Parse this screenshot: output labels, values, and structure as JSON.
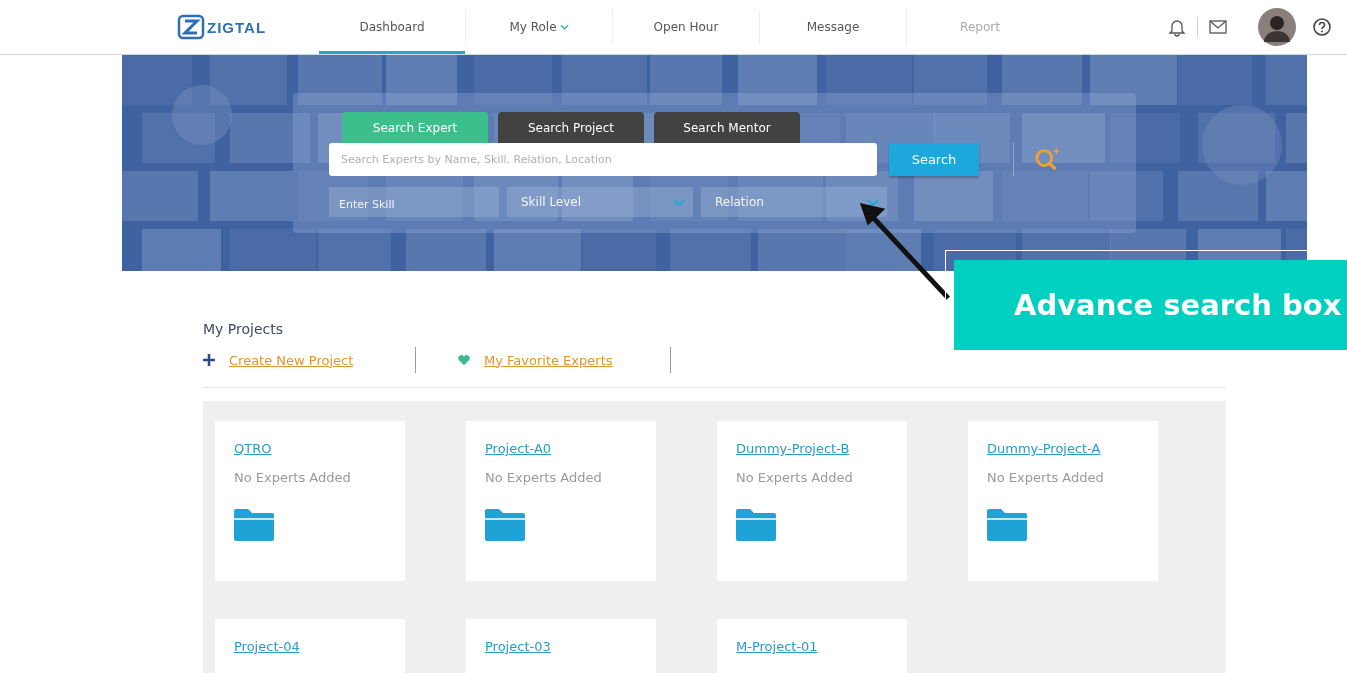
{
  "header": {
    "logo": "ZIGTAL",
    "nav": [
      {
        "label": "Dashboard",
        "selected": true,
        "disabled": false,
        "dropdown": false
      },
      {
        "label": "My Role",
        "selected": false,
        "disabled": false,
        "dropdown": true
      },
      {
        "label": "Open Hour",
        "selected": false,
        "disabled": false,
        "dropdown": false
      },
      {
        "label": "Message",
        "selected": false,
        "disabled": false,
        "dropdown": false
      },
      {
        "label": "Report",
        "selected": false,
        "disabled": true,
        "dropdown": false
      }
    ]
  },
  "search": {
    "tabs": [
      {
        "label": "Search Expert",
        "selected": true
      },
      {
        "label": "Search Project",
        "selected": false
      },
      {
        "label": "Search Mentor",
        "selected": false
      }
    ],
    "placeholder": "Search Experts by Name, Skill, Relation, Location",
    "button": "Search",
    "filters": [
      {
        "kind": "text",
        "placeholder": "Enter Skill"
      },
      {
        "kind": "select",
        "label": "Skill Level"
      },
      {
        "kind": "select",
        "label": "Relation"
      }
    ]
  },
  "callout": "Advance search box",
  "projects": {
    "title": "My Projects",
    "actions": [
      {
        "kind": "create",
        "label": "Create New Project"
      },
      {
        "kind": "favorite",
        "label": "My Favorite Experts"
      }
    ],
    "cards": [
      {
        "name": "QTRO",
        "status": "No Experts Added"
      },
      {
        "name": "Project-A0",
        "status": "No Experts Added"
      },
      {
        "name": "Dummy-Project-B",
        "status": "No Experts Added"
      },
      {
        "name": "Dummy-Project-A",
        "status": "No Experts Added"
      },
      {
        "name": "Project-04"
      },
      {
        "name": "Project-03"
      },
      {
        "name": "M-Project-01"
      }
    ]
  }
}
